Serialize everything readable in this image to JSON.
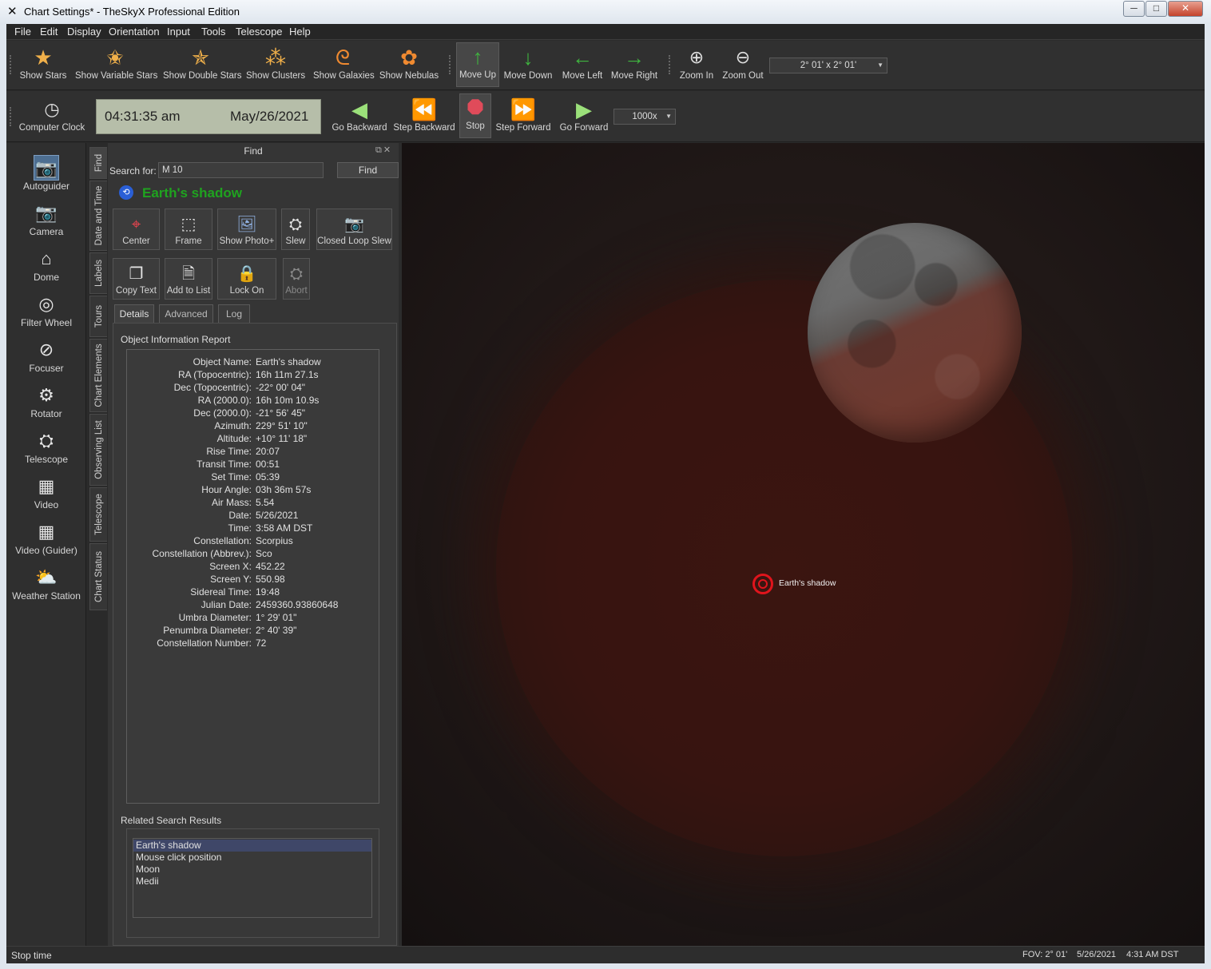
{
  "window": {
    "title": "Chart Settings* - TheSkyX Professional Edition",
    "min_label": "─",
    "max_label": "□",
    "close_label": "✕"
  },
  "menu": [
    "File",
    "Edit",
    "Display",
    "Orientation",
    "Input",
    "Tools",
    "Telescope",
    "Help"
  ],
  "toolbar1": {
    "buttons": [
      "Show Stars",
      "Show Variable Stars",
      "Show Double Stars",
      "Show Clusters",
      "Show Galaxies",
      "Show Nebulas",
      "Move Up",
      "Move Down",
      "Move Left",
      "Move Right",
      "Zoom In",
      "Zoom Out"
    ],
    "fov_combo": "2° 01' x 2° 01'"
  },
  "toolbar2": {
    "computer_clock": "Computer Clock",
    "time": "04:31:35 am",
    "date": "May/26/2021",
    "buttons": [
      "Go Backward",
      "Step Backward",
      "Stop",
      "Step Forward",
      "Go Forward"
    ],
    "speed_combo": "1000x"
  },
  "dock": [
    "Autoguider",
    "Camera",
    "Dome",
    "Filter Wheel",
    "Focuser",
    "Rotator",
    "Telescope",
    "Video",
    "Video (Guider)",
    "Weather Station"
  ],
  "vtabs": [
    "Find",
    "Date and Time",
    "Labels",
    "Tours",
    "Chart Elements",
    "Observing List",
    "Telescope",
    "Chart Status"
  ],
  "find": {
    "title": "Find",
    "search_label": "Search for:",
    "search_value": "M 10",
    "find_button": "Find",
    "object_name": "Earth's shadow",
    "actions_row1": [
      "Center",
      "Frame",
      "Show Photo+",
      "Slew",
      "Closed Loop Slew"
    ],
    "actions_row2": [
      "Copy Text",
      "Add to List",
      "Lock On",
      "Abort"
    ],
    "tabs": [
      "Details",
      "Advanced",
      "Log"
    ],
    "report_title": "Object Information Report",
    "report": [
      {
        "k": "Object Name:",
        "v": "Earth's shadow"
      },
      {
        "k": "RA (Topocentric):",
        "v": "16h 11m 27.1s"
      },
      {
        "k": "Dec (Topocentric):",
        "v": "-22° 00' 04\""
      },
      {
        "k": "RA (2000.0):",
        "v": "16h 10m 10.9s"
      },
      {
        "k": "Dec (2000.0):",
        "v": "-21° 56' 45\""
      },
      {
        "k": "Azimuth:",
        "v": "229° 51' 10\""
      },
      {
        "k": "Altitude:",
        "v": "+10° 11' 18\""
      },
      {
        "k": "Rise Time:",
        "v": "20:07"
      },
      {
        "k": "Transit Time:",
        "v": "00:51"
      },
      {
        "k": "Set Time:",
        "v": "05:39"
      },
      {
        "k": "Hour Angle:",
        "v": "03h 36m 57s"
      },
      {
        "k": "Air Mass:",
        "v": "5.54"
      },
      {
        "k": "Date:",
        "v": "5/26/2021"
      },
      {
        "k": "Time:",
        "v": "3:58 AM DST"
      },
      {
        "k": "Constellation:",
        "v": "Scorpius"
      },
      {
        "k": "Constellation (Abbrev.):",
        "v": "Sco"
      },
      {
        "k": "Screen X:",
        "v": "452.22"
      },
      {
        "k": "Screen Y:",
        "v": "550.98"
      },
      {
        "k": "Sidereal Time:",
        "v": "19:48"
      },
      {
        "k": "Julian Date:",
        "v": "2459360.93860648"
      },
      {
        "k": "Umbra Diameter:",
        "v": "1° 29' 01\""
      },
      {
        "k": "Penumbra Diameter:",
        "v": "2° 40' 39\""
      },
      {
        "k": "Constellation Number:",
        "v": "72"
      }
    ],
    "related_title": "Related Search Results",
    "related": [
      "Earth's shadow",
      "Mouse click position",
      "Moon",
      "Medii"
    ]
  },
  "chart": {
    "marker_label": "Earth's shadow"
  },
  "status": {
    "left": "Stop time",
    "fov": "FOV: 2° 01'",
    "date": "5/26/2021",
    "time": "4:31 AM DST"
  }
}
